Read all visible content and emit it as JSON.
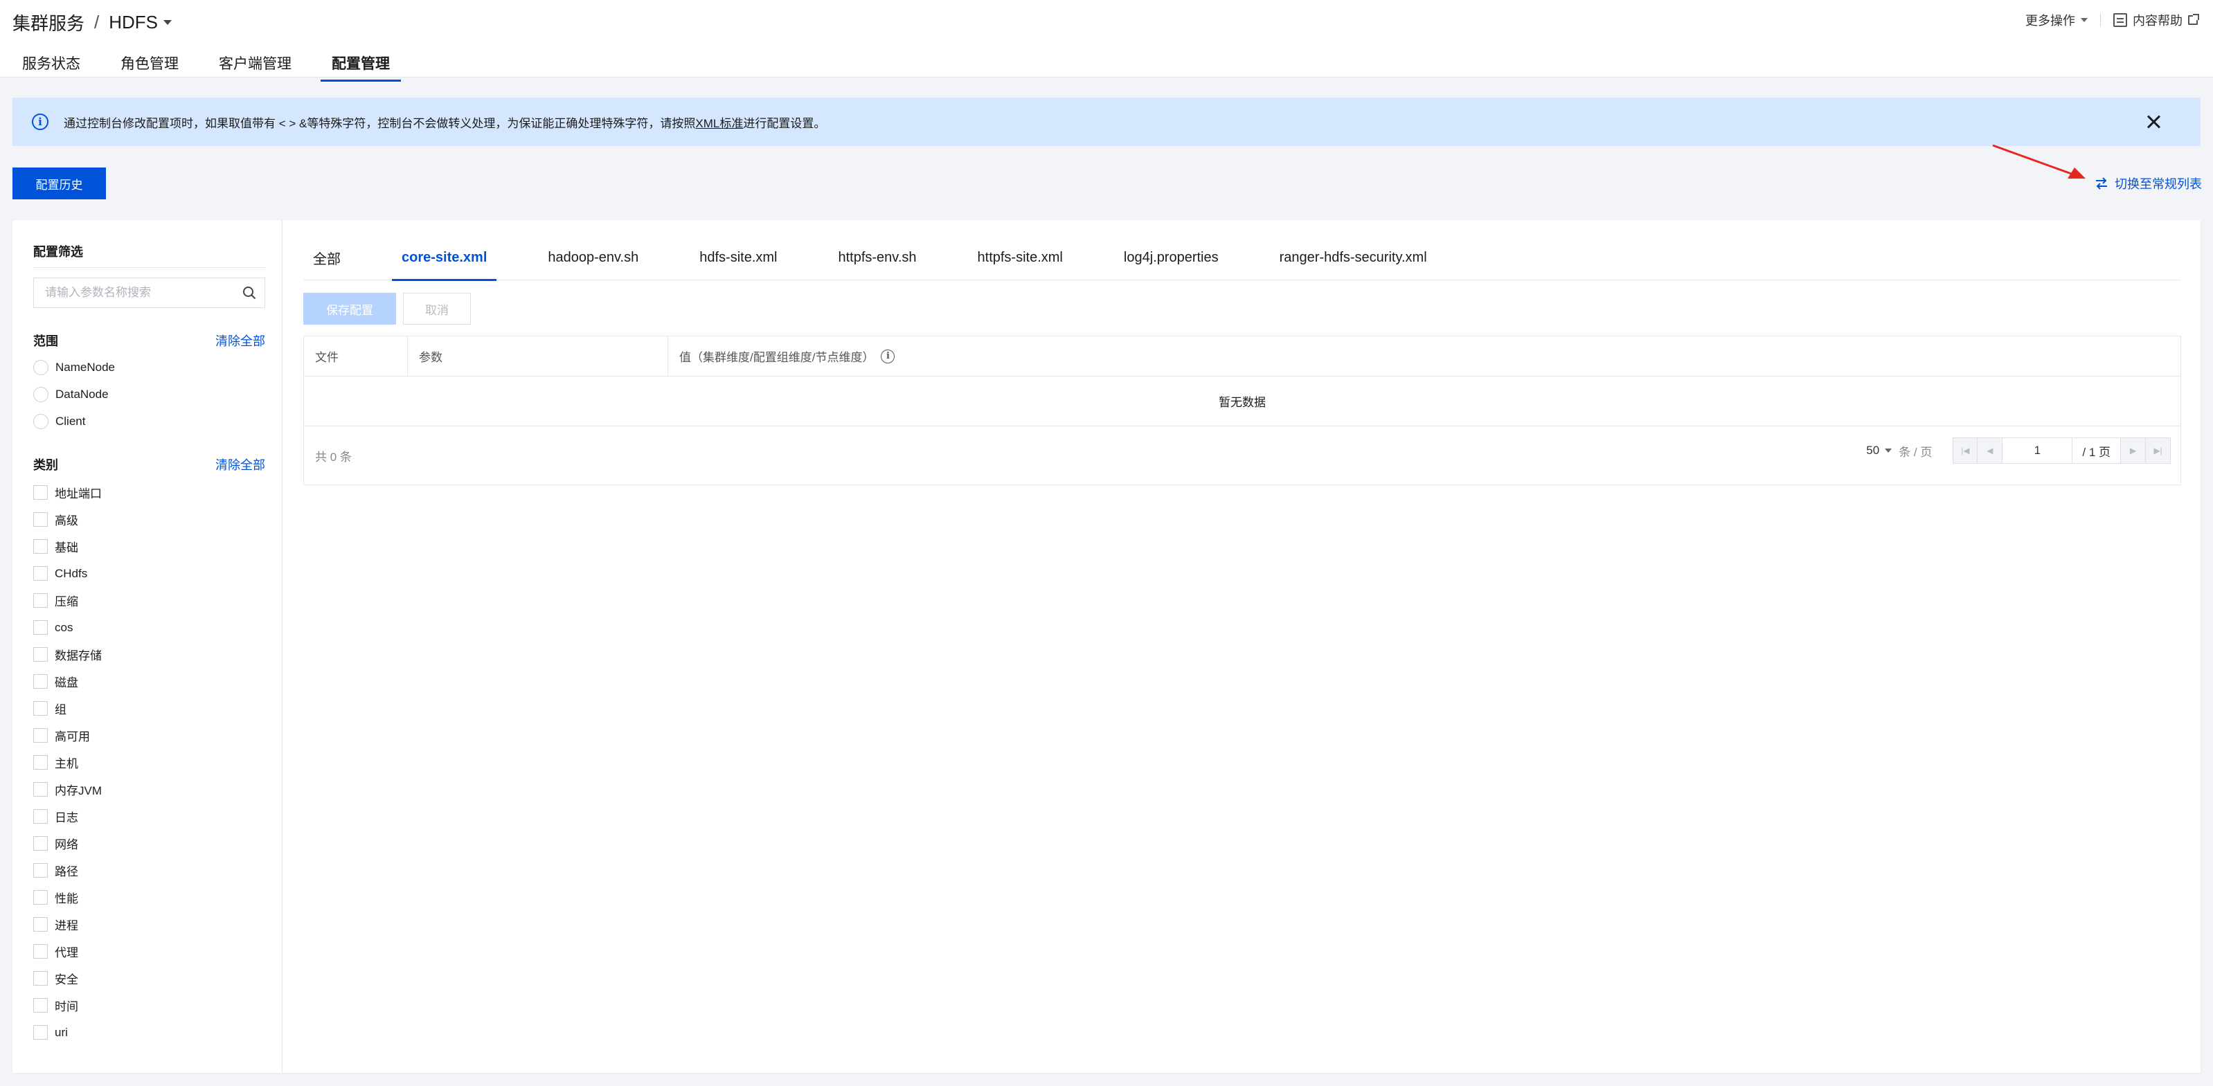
{
  "header": {
    "breadcrumb_root": "集群服务",
    "breadcrumb_sep": "/",
    "service": "HDFS",
    "more_actions": "更多操作",
    "help": "内容帮助"
  },
  "main_tabs": [
    {
      "label": "服务状态"
    },
    {
      "label": "角色管理"
    },
    {
      "label": "客户端管理"
    },
    {
      "label": "配置管理",
      "active": true
    }
  ],
  "alert": {
    "text_before": "通过控制台修改配置项时，如果取值带有 < > &等特殊字符，控制台不会做转义处理，为保证能正确处理特殊字符，请按照",
    "link": "XML标准",
    "text_after": "进行配置设置。"
  },
  "history_button": "配置历史",
  "switch_link": "切换至常规列表",
  "sidebar": {
    "title": "配置筛选",
    "search_placeholder": "请输入参数名称搜索",
    "scope": {
      "label": "范围",
      "clear": "清除全部",
      "items": [
        "NameNode",
        "DataNode",
        "Client"
      ]
    },
    "category": {
      "label": "类别",
      "clear": "清除全部",
      "items": [
        "地址端口",
        "高级",
        "基础",
        "CHdfs",
        "压缩",
        "cos",
        "数据存储",
        "磁盘",
        "组",
        "高可用",
        "主机",
        "内存JVM",
        "日志",
        "网络",
        "路径",
        "性能",
        "进程",
        "代理",
        "安全",
        "时间",
        "uri"
      ]
    }
  },
  "file_tabs": [
    {
      "label": "全部"
    },
    {
      "label": "core-site.xml",
      "active": true
    },
    {
      "label": "hadoop-env.sh"
    },
    {
      "label": "hdfs-site.xml"
    },
    {
      "label": "httpfs-env.sh"
    },
    {
      "label": "httpfs-site.xml"
    },
    {
      "label": "log4j.properties"
    },
    {
      "label": "ranger-hdfs-security.xml"
    }
  ],
  "actions": {
    "save": "保存配置",
    "cancel": "取消"
  },
  "table": {
    "columns": [
      "文件",
      "参数",
      "值（集群维度/配置组维度/节点维度）"
    ],
    "empty": "暂无数据"
  },
  "pager": {
    "total": "共 0 条",
    "page_size": "50",
    "per_page": "条 / 页",
    "current_page": "1",
    "total_pages": "/ 1 页"
  },
  "colors": {
    "accent": "#0052d9",
    "alert_bg": "#d5e7ff",
    "annotation_arrow": "#e8261f"
  }
}
